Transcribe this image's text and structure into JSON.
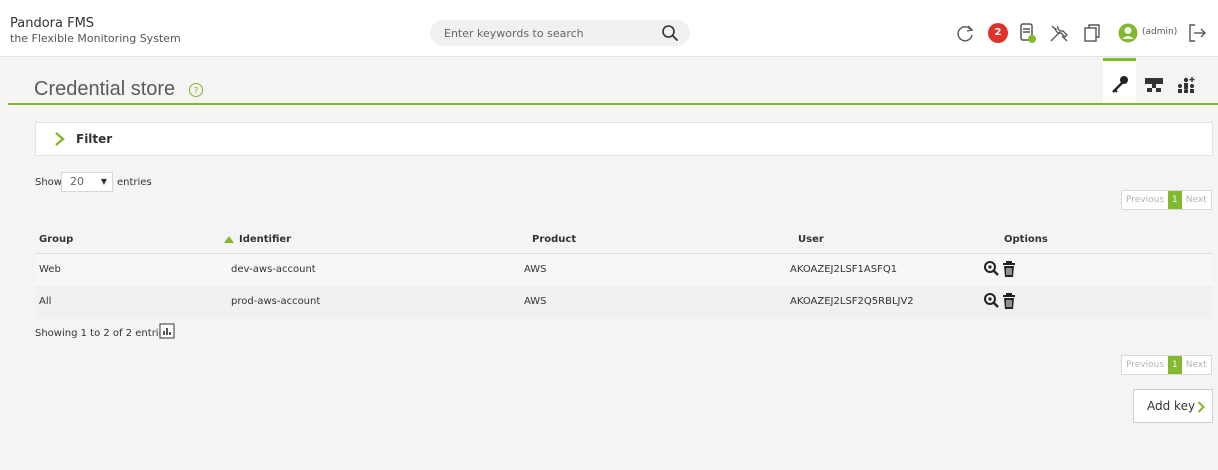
{
  "header": {
    "brand_title": "Pandora FMS",
    "brand_subtitle": "the Flexible Monitoring System",
    "search_placeholder": "Enter keywords to search",
    "notification_count": "2",
    "user_label": "(admin)"
  },
  "page": {
    "title": "Credential store",
    "filter_label": "Filter",
    "show_label": "Show",
    "entries_value": "20",
    "entries_label": "entries",
    "showing_text": "Showing 1 to 2 of 2 entries",
    "add_button_label": "Add key"
  },
  "pager": {
    "previous": "Previous",
    "current": "1",
    "next": "Next"
  },
  "table": {
    "columns": [
      "Group",
      "Identifier",
      "Product",
      "User",
      "Options"
    ],
    "rows": [
      {
        "group": "Web",
        "identifier": "dev-aws-account",
        "product": "AWS",
        "user": "AKOAZEJ2LSF1ASFQ1"
      },
      {
        "group": "All",
        "identifier": "prod-aws-account",
        "product": "AWS",
        "user": "AKOAZEJ2LSF2Q5RBLJV2"
      }
    ]
  },
  "colors": {
    "accent": "#82b92e",
    "badge": "#e0312b"
  },
  "icons": [
    "search-icon",
    "refresh-icon",
    "notification-badge",
    "database-icon",
    "tools-icon",
    "copy-icon",
    "user-avatar-icon",
    "logout-icon",
    "help-icon",
    "key-icon",
    "network-icon",
    "users-icon",
    "chevron-right-icon",
    "magnifier-icon",
    "trash-icon",
    "csv-export-icon"
  ]
}
